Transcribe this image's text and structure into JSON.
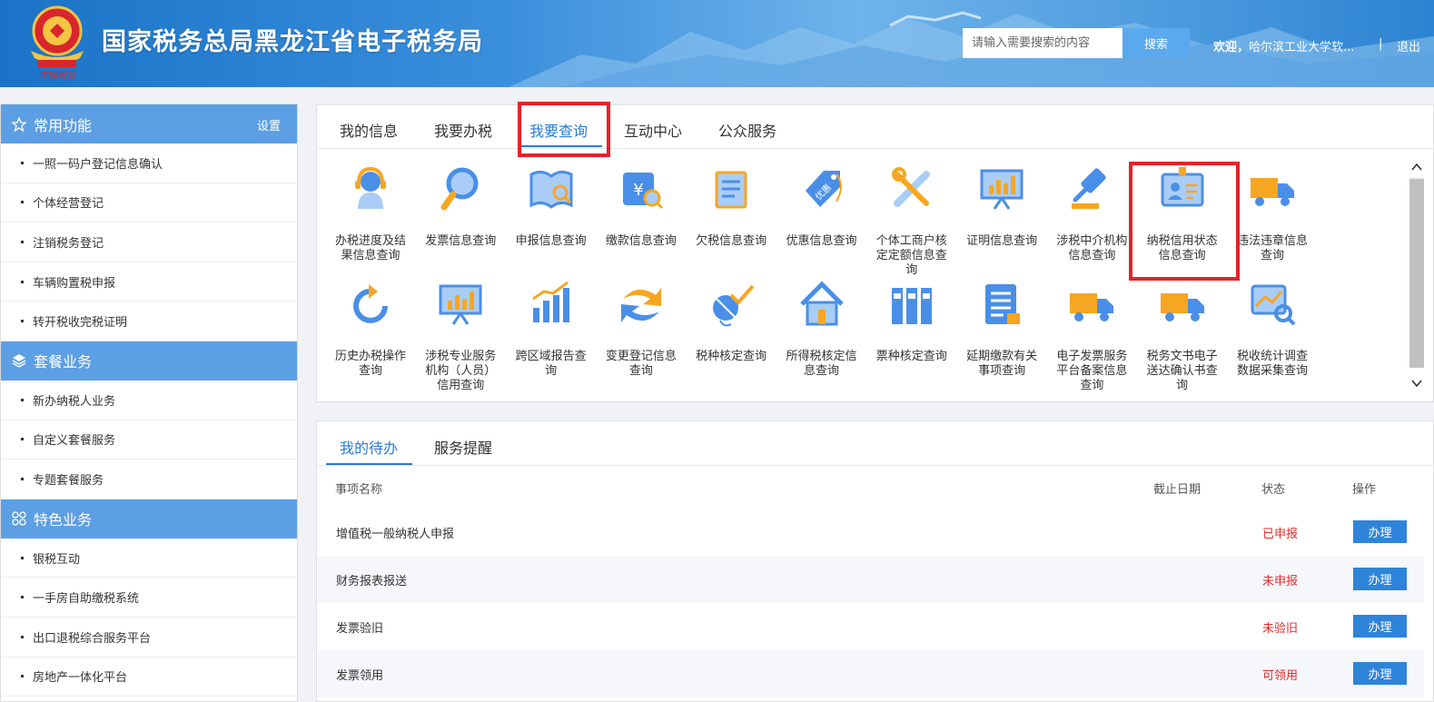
{
  "header": {
    "title": "国家税务总局黑龙江省电子税务局",
    "search_placeholder": "请输入需要搜索的内容",
    "search_button": "搜索",
    "welcome_prefix": "欢迎，",
    "welcome_user": "哈尔滨工业大学软...",
    "separator": "|",
    "logout": "退出"
  },
  "sidebar": {
    "groups": [
      {
        "title": "常用功能",
        "setting": "设置",
        "icon": "star-icon",
        "items": [
          "一照一码户登记信息确认",
          "个体经营登记",
          "注销税务登记",
          "车辆购置税申报",
          "转开税收完税证明"
        ]
      },
      {
        "title": "套餐业务",
        "icon": "layers-icon",
        "items": [
          "新办纳税人业务",
          "自定义套餐服务",
          "专题套餐服务"
        ]
      },
      {
        "title": "特色业务",
        "icon": "apps-icon",
        "items": [
          "银税互动",
          "一手房自助缴税系统",
          "出口退税综合服务平台",
          "房地产一体化平台"
        ]
      }
    ]
  },
  "main_tabs": [
    "我的信息",
    "我要办税",
    "我要查询",
    "互动中心",
    "公众服务"
  ],
  "query_items": [
    {
      "label": "办税进度及结果信息查询",
      "icon": "customer-service-icon"
    },
    {
      "label": "发票信息查询",
      "icon": "magnifier-icon"
    },
    {
      "label": "申报信息查询",
      "icon": "book-search-icon"
    },
    {
      "label": "缴款信息查询",
      "icon": "payment-search-icon"
    },
    {
      "label": "欠税信息查询",
      "icon": "document-scroll-icon"
    },
    {
      "label": "优惠信息查询",
      "icon": "discount-tag-icon"
    },
    {
      "label": "个体工商户核定定额信息查询",
      "icon": "tools-icon"
    },
    {
      "label": "证明信息查询",
      "icon": "presentation-chart-icon"
    },
    {
      "label": "涉税中介机构信息查询",
      "icon": "gavel-icon"
    },
    {
      "label": "纳税信用状态信息查询",
      "icon": "id-card-icon"
    },
    {
      "label": "违法违章信息查询",
      "icon": "truck-icon"
    },
    {
      "label": "历史办税操作查询",
      "icon": "refresh-icon"
    },
    {
      "label": "涉税专业服务机构（人员）信用查询",
      "icon": "presentation-chart-icon"
    },
    {
      "label": "跨区域报告查询",
      "icon": "bar-chart-icon"
    },
    {
      "label": "变更登记信息查询",
      "icon": "exchange-arrows-icon"
    },
    {
      "label": "税种核定查询",
      "icon": "satellite-icon"
    },
    {
      "label": "所得税核定信息查询",
      "icon": "house-icon"
    },
    {
      "label": "票种核定查询",
      "icon": "binders-icon"
    },
    {
      "label": "延期缴款有关事项查询",
      "icon": "document-list-icon"
    },
    {
      "label": "电子发票服务平台备案信息查询",
      "icon": "truck-icon"
    },
    {
      "label": "税务文书电子送达确认书查询",
      "icon": "truck-icon"
    },
    {
      "label": "税收统计调查数据采集查询",
      "icon": "chart-search-icon"
    }
  ],
  "bottom_tabs": [
    "我的待办",
    "服务提醒"
  ],
  "table": {
    "headers": {
      "name": "事项名称",
      "deadline": "截止日期",
      "status": "状态",
      "action": "操作"
    },
    "rows": [
      {
        "name": "增值税一般纳税人申报",
        "deadline": "",
        "status": "已申报",
        "action": "办理"
      },
      {
        "name": "财务报表报送",
        "deadline": "",
        "status": "未申报",
        "action": "办理"
      },
      {
        "name": "发票验旧",
        "deadline": "",
        "status": "未验旧",
        "action": "办理"
      },
      {
        "name": "发票领用",
        "deadline": "",
        "status": "可领用",
        "action": "办理"
      }
    ]
  },
  "colors": {
    "accent": "#2a7ad6",
    "sidebar_head": "#5d9fe4",
    "status_red": "#e02c2c",
    "highlight_red": "#e8212a",
    "icon_blue": "#4a8fe7",
    "icon_orange": "#f6a623"
  }
}
